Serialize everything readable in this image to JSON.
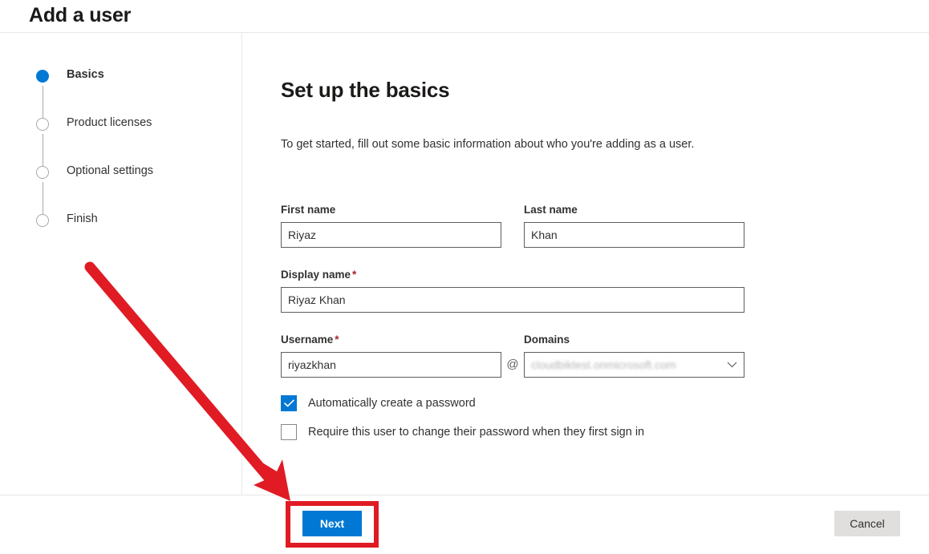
{
  "header": {
    "title": "Add a user"
  },
  "wizard": {
    "steps": [
      {
        "label": "Basics",
        "state": "active"
      },
      {
        "label": "Product licenses",
        "state": "inactive"
      },
      {
        "label": "Optional settings",
        "state": "inactive"
      },
      {
        "label": "Finish",
        "state": "inactive"
      }
    ]
  },
  "main": {
    "title": "Set up the basics",
    "description": "To get started, fill out some basic information about who you're adding as a user.",
    "fields": {
      "first_name": {
        "label": "First name",
        "value": "Riyaz",
        "required": false
      },
      "last_name": {
        "label": "Last name",
        "value": "Khan",
        "required": false
      },
      "display_name": {
        "label": "Display name",
        "value": "Riyaz Khan",
        "required": true,
        "required_marker": "*"
      },
      "username": {
        "label": "Username",
        "value": "riyazkhan",
        "required": true,
        "required_marker": "*"
      },
      "domains": {
        "label": "Domains",
        "value": "cloudbiktest.onmicrosoft.com",
        "separator": "@"
      }
    },
    "checkboxes": [
      {
        "label": "Automatically create a password",
        "checked": true
      },
      {
        "label": "Require this user to change their password when they first sign in",
        "checked": false
      }
    ]
  },
  "footer": {
    "next_label": "Next",
    "cancel_label": "Cancel"
  },
  "annotations": {
    "arrow_color": "#e01b24",
    "highlight_color": "#e01b24"
  },
  "colors": {
    "accent_blue": "#0078d4",
    "required_red": "#a4262c",
    "annotation_red": "#e01b24",
    "text": "#323130",
    "border": "#605e5c"
  }
}
